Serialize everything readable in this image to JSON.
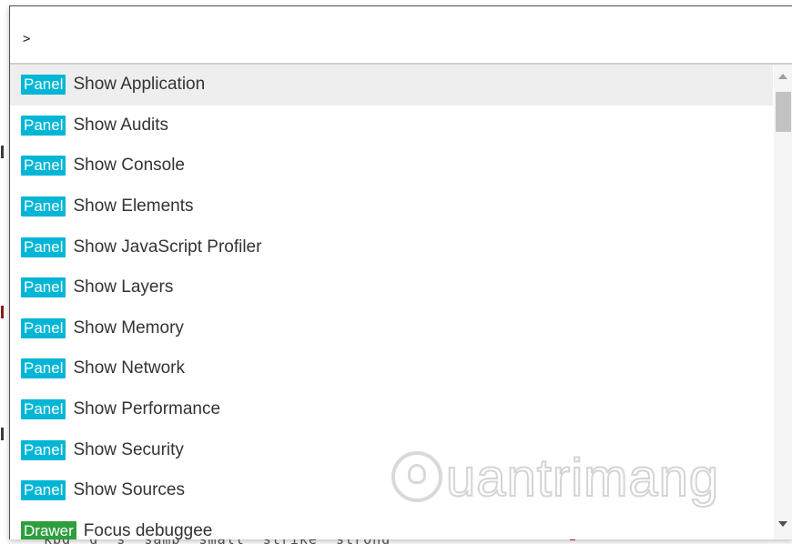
{
  "prompt": {
    "value": ">"
  },
  "commands": [
    {
      "category": "Panel",
      "label": "Show Application",
      "selected": true
    },
    {
      "category": "Panel",
      "label": "Show Audits"
    },
    {
      "category": "Panel",
      "label": "Show Console"
    },
    {
      "category": "Panel",
      "label": "Show Elements"
    },
    {
      "category": "Panel",
      "label": "Show JavaScript Profiler"
    },
    {
      "category": "Panel",
      "label": "Show Layers"
    },
    {
      "category": "Panel",
      "label": "Show Memory"
    },
    {
      "category": "Panel",
      "label": "Show Network"
    },
    {
      "category": "Panel",
      "label": "Show Performance"
    },
    {
      "category": "Panel",
      "label": "Show Security"
    },
    {
      "category": "Panel",
      "label": "Show Sources"
    },
    {
      "category": "Drawer",
      "label": "Focus debuggee"
    }
  ],
  "background": {
    "bottom_code": "kbd  q  s  samp  small  strike  strong"
  },
  "watermark": {
    "text": "uantrimang"
  },
  "colors": {
    "panel_badge": "#00b6d6",
    "drawer_badge": "#2e9e3e",
    "selected_row": "#eeeeee"
  }
}
